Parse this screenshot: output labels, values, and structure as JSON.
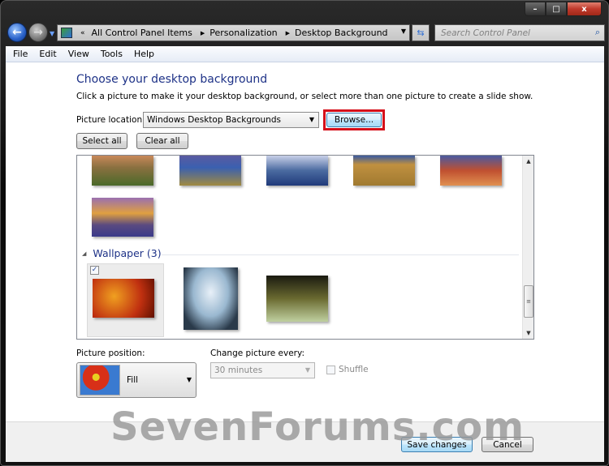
{
  "window": {
    "controls": {
      "minimize": "–",
      "maximize": "□",
      "close": "x"
    }
  },
  "navigation": {
    "back_icon": "back-arrow-icon",
    "forward_icon": "forward-arrow-icon",
    "address": {
      "overflow": "«",
      "crumbs": [
        "All Control Panel Items",
        "Personalization",
        "Desktop Background"
      ]
    },
    "search_placeholder": "Search Control Panel"
  },
  "menu": [
    "File",
    "Edit",
    "View",
    "Tools",
    "Help"
  ],
  "page": {
    "title": "Choose your desktop background",
    "description": "Click a picture to make it your desktop background, or select more than one picture to create a slide show.",
    "location_label": "Picture location:",
    "location_value": "Windows Desktop Backgrounds",
    "browse_label": "Browse...",
    "select_all_label": "Select all",
    "clear_all_label": "Clear all"
  },
  "gallery": {
    "groups": [
      {
        "name": "Windows Desktop Backgrounds",
        "items": [
          "field-sunset",
          "lighthouse",
          "rock-reflection",
          "hay-bale",
          "arch",
          "lupine-sunset"
        ]
      },
      {
        "name": "Wallpaper (3)",
        "items": [
          {
            "name": "fire-figure",
            "checked": true
          },
          {
            "name": "alien",
            "checked": false
          },
          {
            "name": "windows-seven-hand",
            "checked": false
          }
        ]
      }
    ]
  },
  "options": {
    "position_label": "Picture position:",
    "position_value": "Fill",
    "interval_label": "Change picture every:",
    "interval_value": "30 minutes",
    "shuffle_label": "Shuffle",
    "shuffle_checked": false
  },
  "footer": {
    "save_label": "Save changes",
    "cancel_label": "Cancel"
  },
  "watermark": "SevenForums.com"
}
